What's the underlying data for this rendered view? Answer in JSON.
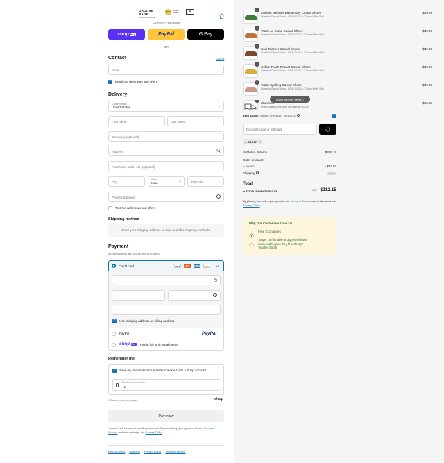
{
  "brand": {
    "name": "GROOVE BAGE",
    "sub": "Groove Checkout",
    "badges": [
      "WBENC",
      "Women Owned",
      "B"
    ]
  },
  "express": {
    "label": "Express checkout",
    "shop_pay": "shop",
    "shop_pay_tag": "Pay",
    "paypal": "PayPal",
    "gpay": "G Pay",
    "or": "OR"
  },
  "contact": {
    "heading": "Contact",
    "login": "Log in",
    "email_placeholder": "Email",
    "news": "Email me with news and offers"
  },
  "delivery": {
    "heading": "Delivery",
    "country_label": "Country/Region",
    "country_value": "United States",
    "first_name": "First name",
    "last_name": "Last name",
    "company": "Company (optional)",
    "address": "Address",
    "apartment": "Apartment, suite, etc. (optional)",
    "city": "City",
    "state_label": "State",
    "state_value": "Iowa",
    "zip": "ZIP code",
    "phone": "Phone (optional)",
    "text_news": "Text me with news and offers"
  },
  "shipping": {
    "heading": "Shipping method",
    "note": "Enter your shipping address to view available shipping methods."
  },
  "payment": {
    "heading": "Payment",
    "sub": "All transactions are secure and encrypted.",
    "credit_card": "Credit card",
    "card_logos": [
      "VISA",
      "MC",
      "AMEX",
      "DISC"
    ],
    "more_cards": "+4",
    "billing_same": "Use shipping address as billing address",
    "paypal": "PayPal",
    "paypal_logo": "PayPal",
    "shop_pay_logo": "shop",
    "shop_pay_tag": "Pay",
    "shop_pay_text": "Pay in full or in installments"
  },
  "remember": {
    "heading": "Remember me",
    "save": "Save my information for a faster checkout with a Shop account",
    "mobile_label": "Mobile phone number",
    "mobile_prefix": "+1",
    "secure": "Secure and encrypted",
    "shop_logo": "shop"
  },
  "pay_now": "Pay now",
  "disclaimer": {
    "text1": "Your info will be saved to a Shop account. By continuing, you agree to Shop's",
    "tos": "Terms of Service",
    "text2": "and acknowledge the",
    "privacy": "Privacy Policy",
    "end": "."
  },
  "footer_links": [
    "Refund policy",
    "Shipping",
    "Privacy policy",
    "Terms of service"
  ],
  "cart": {
    "items": [
      {
        "qty": "1",
        "name": "Custom Webster Elementary Casual Shoes",
        "variant": "Women's Casual Shoes / US 5 / EU35.5 / Cream White Sole",
        "price": "$49.99",
        "color": "#3f7a3a"
      },
      {
        "qty": "1",
        "name": "Teach As Some Casual Shoes",
        "variant": "Women's Casual Shoes / US 5 / EU35.5 / Cream White Sole",
        "price": "$49.99",
        "color": "#c2703a"
      },
      {
        "qty": "1",
        "name": "Cool Teacher Casual Shoes",
        "variant": "Women's Casual Shoes / US 5 / EU35.5 / Cream White Sole",
        "price": "$49.99",
        "color": "#7a4a30"
      },
      {
        "qty": "1",
        "name": "Coffee Teach Repeat Casual Shoes",
        "variant": "Women's Casual Shoes / US 5 / EU35.5 / Cream White Sole",
        "price": "$49.99",
        "color": "#d4b23a"
      },
      {
        "qty": "1",
        "name": "Teach Spelling Casual Shoes",
        "variant": "Women's Casual Shoes / US 5 / EU35.5 / Cream White Sole",
        "price": "$49.99",
        "color": "#c99a86"
      },
      {
        "qty": "1",
        "name": "Checkout+",
        "variant": "Protect against loss, theft and damage ($2.99)",
        "price": "$15.23",
        "color": "#888888"
      }
    ],
    "scroll_hint": "Scroll for more items",
    "earn": "Earn $20.00",
    "earn_rest": "Onward Checkout+ for $12.63",
    "discount_placeholder": "Discount code or gift card",
    "applied_code": "20OFF",
    "subtotal_label": "Subtotal · 6 items",
    "subtotal_value": "$265.16",
    "order_discount_label": "Order discount",
    "discount_code": "20OFF",
    "discount_value": "- $53.03",
    "shipping_label": "Shipping",
    "total_label": "Total",
    "currency": "USD",
    "total_value": "$212.15",
    "savings_label": "TOTAL SAVINGS",
    "savings_value": "$53.03",
    "agree_text1": "By placing this order, you agree to our",
    "agree_tos": "Terms of Service",
    "agree_text2": "and",
    "agree_text3": "understand our",
    "agree_privacy": "Privacy Policy",
    "agree_end": "."
  },
  "testimonial": {
    "heading": "Why Our Customers Love Us",
    "benefit": "Free Exchanges",
    "quote": "\"Super comfortable and goes well with many outfits, plus they fit perfectly.\" - Teacher Sarah"
  },
  "colors": {
    "accent": "#1773b0",
    "shop_pay": "#5a31f4",
    "paypal": "#ffc439",
    "gpay": "#000000",
    "testimonial_bg": "#fdf6dc",
    "testimonial_text": "#2f6b3a"
  }
}
